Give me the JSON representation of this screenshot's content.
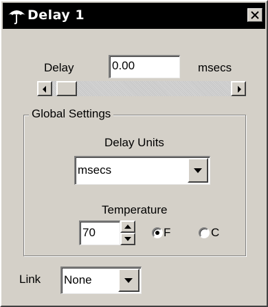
{
  "window": {
    "title": "Delay 1"
  },
  "delay": {
    "label": "Delay",
    "value": "0.00",
    "units": "msecs"
  },
  "global_settings": {
    "title": "Global Settings",
    "delay_units_label": "Delay Units",
    "delay_units_value": "msecs",
    "temperature_label": "Temperature",
    "temperature_value": "70",
    "unit_f": "F",
    "unit_c": "C",
    "selected_unit": "F"
  },
  "link": {
    "label": "Link",
    "value": "None"
  },
  "icons": {
    "app": "umbrella-icon",
    "close": "close-icon"
  }
}
